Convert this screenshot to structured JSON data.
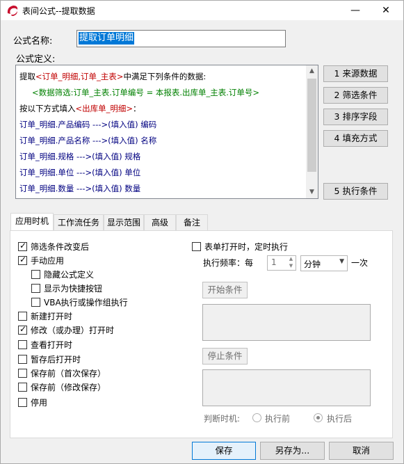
{
  "window": {
    "title": "表间公式--提取数据",
    "minimize_glyph": "—",
    "maximize_glyph": "☐",
    "close_glyph": "✕"
  },
  "form": {
    "name_label": "公式名称:",
    "name_value": "提取订单明细",
    "definition_label": "公式定义:"
  },
  "definition": {
    "line1_pre": "提取",
    "line1_src": "<订单_明细,订单_主表>",
    "line1_post": "中满足下列条件的数据:",
    "line2": "<数据筛选:订单_主表.订单编号 = 本报表.出库单_主表.订单号>",
    "line3_pre": "按以下方式填入",
    "line3_dst": "<出库单_明细>",
    "line3_post": "：",
    "mappings": [
      "订单_明细.产品编码  --->(填入值) 编码",
      "订单_明细.产品名称  --->(填入值) 名称",
      "订单_明细.规格  --->(填入值) 规格",
      "订单_明细.单位  --->(填入值) 单位",
      "订单_明细.数量  --->(填入值) 数量"
    ]
  },
  "side_buttons": [
    "1 来源数据",
    "2 筛选条件",
    "3 排序字段",
    "4 填充方式",
    "5 执行条件"
  ],
  "tabs": [
    "应用时机",
    "工作流任务",
    "显示范围",
    "高级",
    "备注"
  ],
  "left_options": [
    {
      "label": "筛选条件改变后",
      "checked": true
    },
    {
      "label": "手动应用",
      "checked": true
    },
    {
      "label": "隐藏公式定义",
      "checked": false
    },
    {
      "label": "显示为快捷按钮",
      "checked": false
    },
    {
      "label": "VBA执行或操作组执行",
      "checked": false
    },
    {
      "label": "新建打开时",
      "checked": false
    },
    {
      "label": "修改（或办理）打开时",
      "checked": true
    },
    {
      "label": "查看打开时",
      "checked": false
    },
    {
      "label": "暂存后打开时",
      "checked": false
    },
    {
      "label": "保存前（首次保存）",
      "checked": false
    },
    {
      "label": "保存前（修改保存）",
      "checked": false
    },
    {
      "label": "停用",
      "checked": false
    }
  ],
  "timer": {
    "label": "表单打开时，定时执行",
    "freq_label": "执行频率：每",
    "freq_value": "1",
    "unit_value": "分钟",
    "freq_suffix": "一次",
    "start_label": "开始条件",
    "stop_label": "停止条件",
    "judge_label": "判断时机:",
    "before_label": "执行前",
    "after_label": "执行后",
    "selected": "after"
  },
  "footer": {
    "save": "保存",
    "save_as": "另存为...",
    "cancel": "取消"
  },
  "colors": {
    "selection": "#0078d7",
    "red_text": "#c00000",
    "green_text": "#008000",
    "blue_text": "#000080"
  }
}
